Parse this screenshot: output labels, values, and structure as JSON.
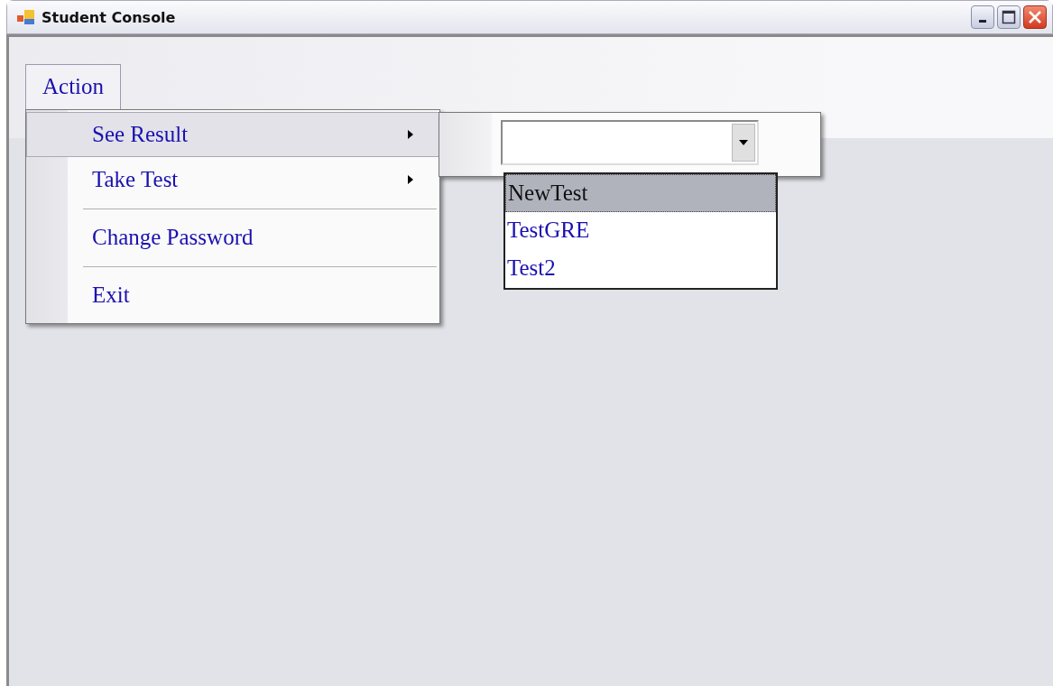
{
  "window": {
    "title": "Student Console"
  },
  "menu_bar": [
    {
      "label": "Action",
      "selected": true
    }
  ],
  "menu": {
    "items": [
      {
        "label": "See Result",
        "has_submenu": true,
        "selected": true,
        "separator_before": false
      },
      {
        "label": "Take Test",
        "has_submenu": true,
        "selected": false,
        "separator_before": false
      },
      {
        "label": "Change Password",
        "has_submenu": false,
        "selected": false,
        "separator_before": true
      },
      {
        "label": "Exit",
        "has_submenu": false,
        "selected": false,
        "separator_before": true
      }
    ]
  },
  "submenu": {
    "combo": {
      "expanded": true,
      "options": [
        {
          "label": "NewTest",
          "selected": true
        },
        {
          "label": "TestGRE",
          "selected": false
        },
        {
          "label": "Test2",
          "selected": false
        }
      ]
    }
  }
}
